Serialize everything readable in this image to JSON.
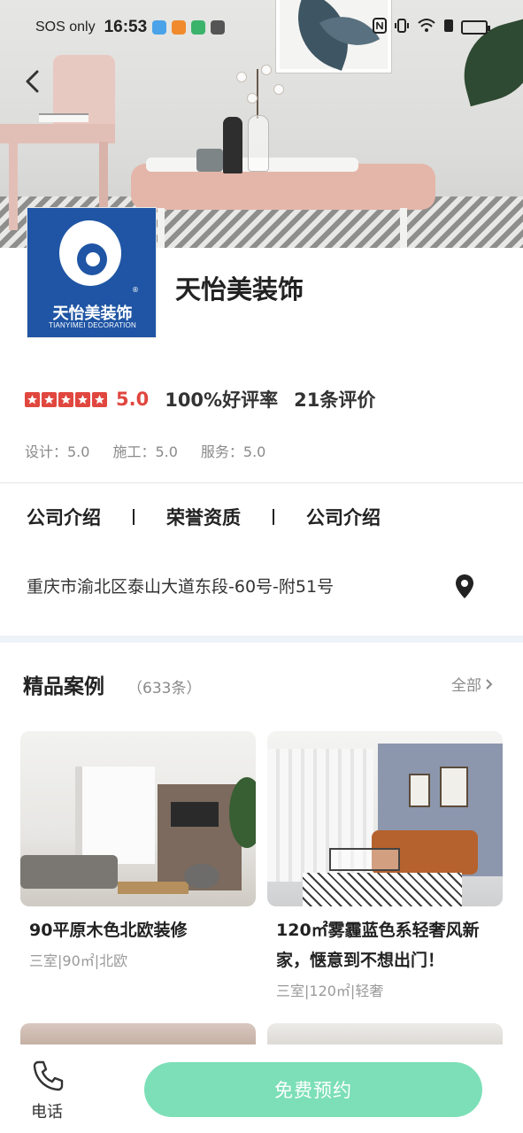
{
  "status_bar": {
    "carrier": "SOS only",
    "time": "16:53"
  },
  "company": {
    "name": "天怡美装饰",
    "logo_text_cn": "天怡美装饰",
    "logo_text_en": "TIANYIMEI DECORATION",
    "rating": "5.0",
    "stars": 5,
    "good_rate": "100%好评率",
    "review_count": "21条评价",
    "sub_scores": {
      "design": "设计：5.0",
      "construction": "施工：5.0",
      "service": "服务：5.0"
    }
  },
  "tabs": [
    {
      "label": "公司介绍"
    },
    {
      "label": "荣誉资质"
    },
    {
      "label": "公司介绍"
    }
  ],
  "address": "重庆市渝北区泰山大道东段-60号-附51号",
  "cases": {
    "title": "精品案例",
    "count": "（633条）",
    "see_all": "全部",
    "items": [
      {
        "title": "90平原木色北欧装修",
        "meta": "三室|90㎡|北欧"
      },
      {
        "title": "120㎡雾霾蓝色系轻奢风新家，惬意到不想出门！",
        "meta": "三室|120㎡|轻奢"
      }
    ]
  },
  "bottom_bar": {
    "phone_label": "电话",
    "cta_label": "免费预约"
  },
  "colors": {
    "accent_red": "#e0473f",
    "cta_green": "#7cdfb7",
    "logo_blue": "#1f55a4"
  }
}
